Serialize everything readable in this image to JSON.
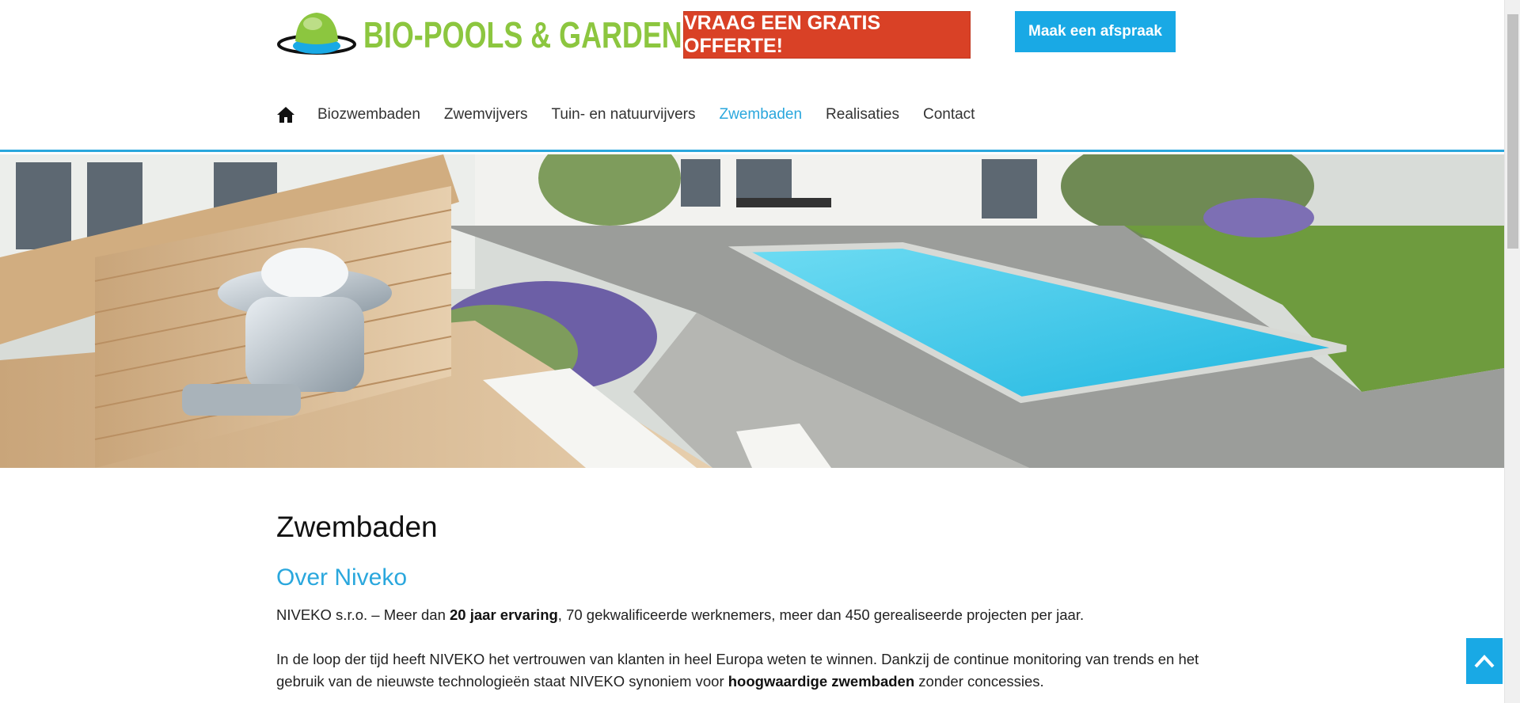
{
  "header": {
    "logo_text": "BIO-POOLS & GARDENS",
    "offer_button": "VRAAG EEN GRATIS OFFERTE!",
    "appointment_button": "Maak een afspraak"
  },
  "nav": {
    "items": [
      {
        "label": "Biozwembaden"
      },
      {
        "label": "Zwemvijvers"
      },
      {
        "label": "Tuin- en natuurvijvers"
      },
      {
        "label": "Zwembaden"
      },
      {
        "label": "Realisaties"
      },
      {
        "label": "Contact"
      }
    ],
    "active": "Zwembaden"
  },
  "main": {
    "title": "Zwembaden",
    "subtitle": "Over Niveko",
    "p1": {
      "before": "NIVEKO s.r.o. – Meer dan ",
      "bold": "20 jaar ervaring",
      "after": ", 70 gekwalificeerde werknemers, meer dan 450 gerealiseerde projecten per jaar."
    },
    "p2": {
      "before": "In de loop der tijd heeft NIVEKO het vertrouwen van klanten in heel Europa weten te winnen. Dankzij de continue monitoring van trends en het gebruik van de nieuwste technologieën staat NIVEKO synoniem voor ",
      "bold": "hoogwaardige zwembaden",
      "after": " zonder concessies."
    }
  },
  "colors": {
    "brand_green": "#8cc63f",
    "accent_blue": "#2aa7dd",
    "offer_red": "#d94126"
  }
}
